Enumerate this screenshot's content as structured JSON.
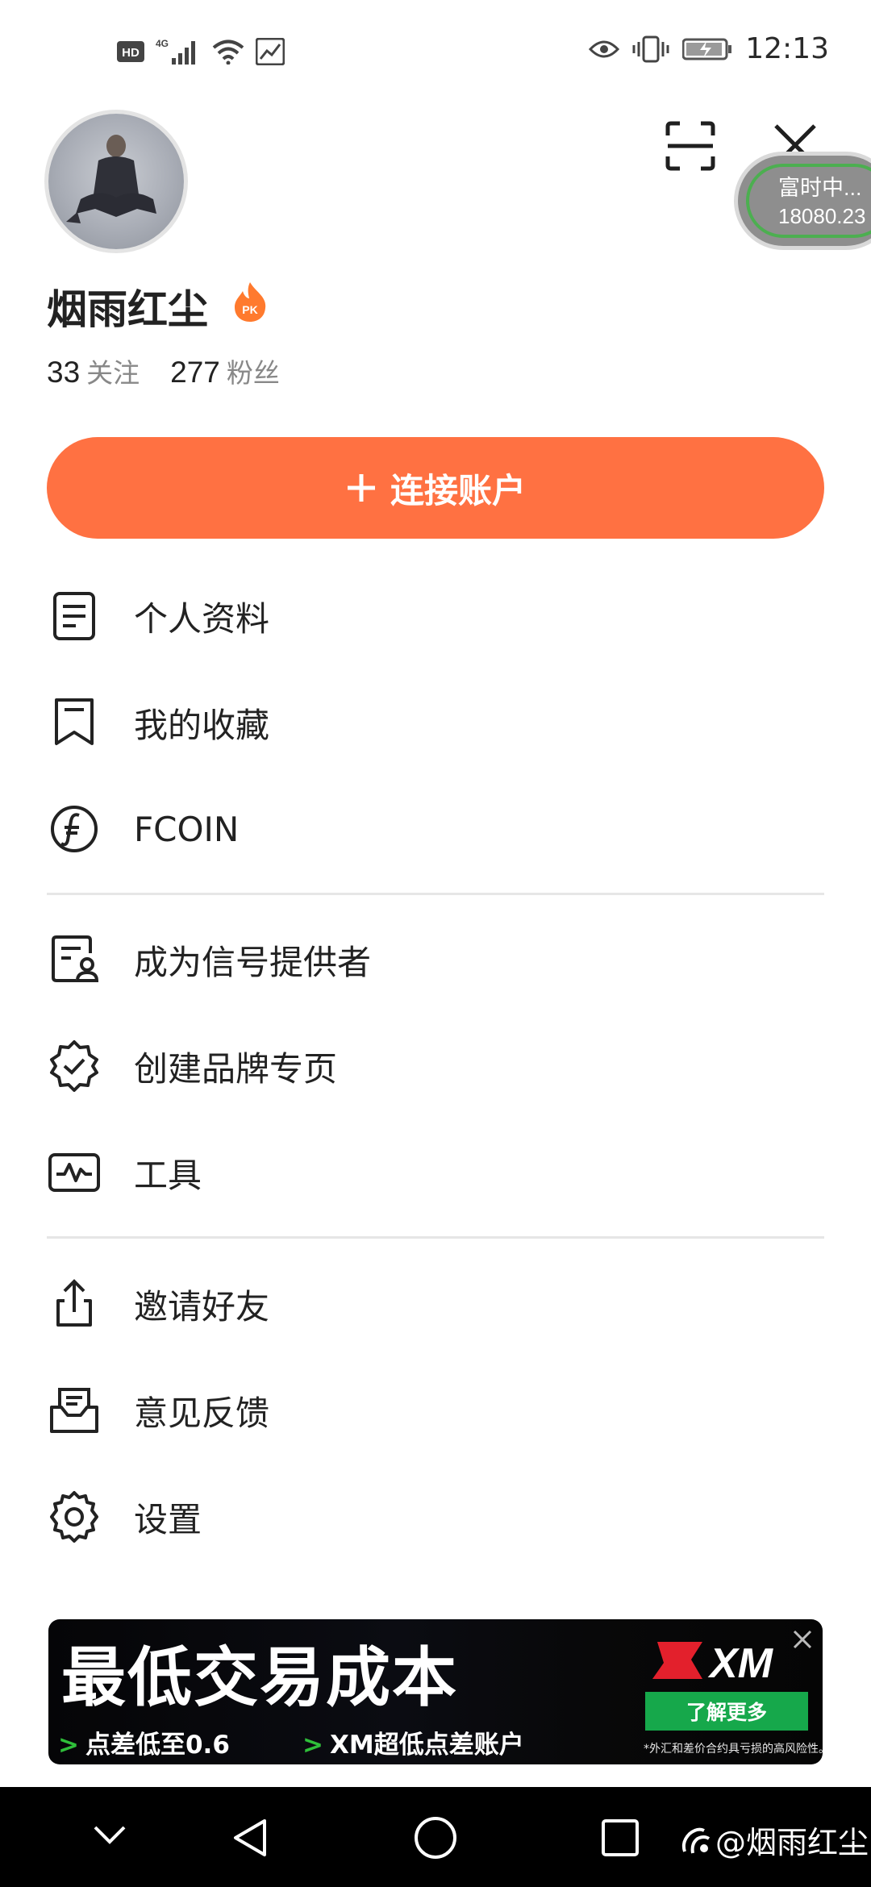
{
  "status_bar": {
    "time": "12:13",
    "left_icons": [
      "hd-icon",
      "4g-signal-icon",
      "wifi-icon",
      "screenshot-notification-icon"
    ],
    "right_icons": [
      "eye-icon",
      "vibrate-icon",
      "battery-icon"
    ]
  },
  "header": {
    "scan_icon": "scan-icon",
    "close_icon": "close-icon"
  },
  "ticker": {
    "name": "富时中...",
    "value": "18080.23",
    "color": "#4caf50"
  },
  "profile": {
    "username": "烟雨红尘",
    "badge_text": "PK",
    "following_count": "33",
    "following_label": "关注",
    "followers_count": "277",
    "followers_label": "粉丝"
  },
  "connect_button": {
    "label": "连接账户",
    "color": "#ff7142"
  },
  "menu": {
    "group1": [
      {
        "label": "个人资料",
        "icon": "document-icon"
      },
      {
        "label": "我的收藏",
        "icon": "bookmark-icon"
      },
      {
        "label": "FCOIN",
        "icon": "fcoin-icon"
      }
    ],
    "group2": [
      {
        "label": "成为信号提供者",
        "icon": "signal-provider-icon"
      },
      {
        "label": "创建品牌专页",
        "icon": "verified-badge-icon"
      },
      {
        "label": "工具",
        "icon": "pulse-chart-icon"
      }
    ],
    "group3": [
      {
        "label": "邀请好友",
        "icon": "share-icon"
      },
      {
        "label": "意见反馈",
        "icon": "feedback-icon"
      },
      {
        "label": "设置",
        "icon": "gear-icon"
      }
    ]
  },
  "ad": {
    "headline": "最低交易成本",
    "point1": "点差低至0.6",
    "point2": "XM超低点差账户",
    "logo": "XM",
    "cta": "了解更多",
    "disclaimer": "*外汇和差价合约具亏损的高风险性。"
  },
  "nav_bar": {
    "buttons": [
      "collapse-icon",
      "back-icon",
      "home-icon",
      "recents-icon"
    ],
    "watermark": "@烟雨红尘"
  }
}
